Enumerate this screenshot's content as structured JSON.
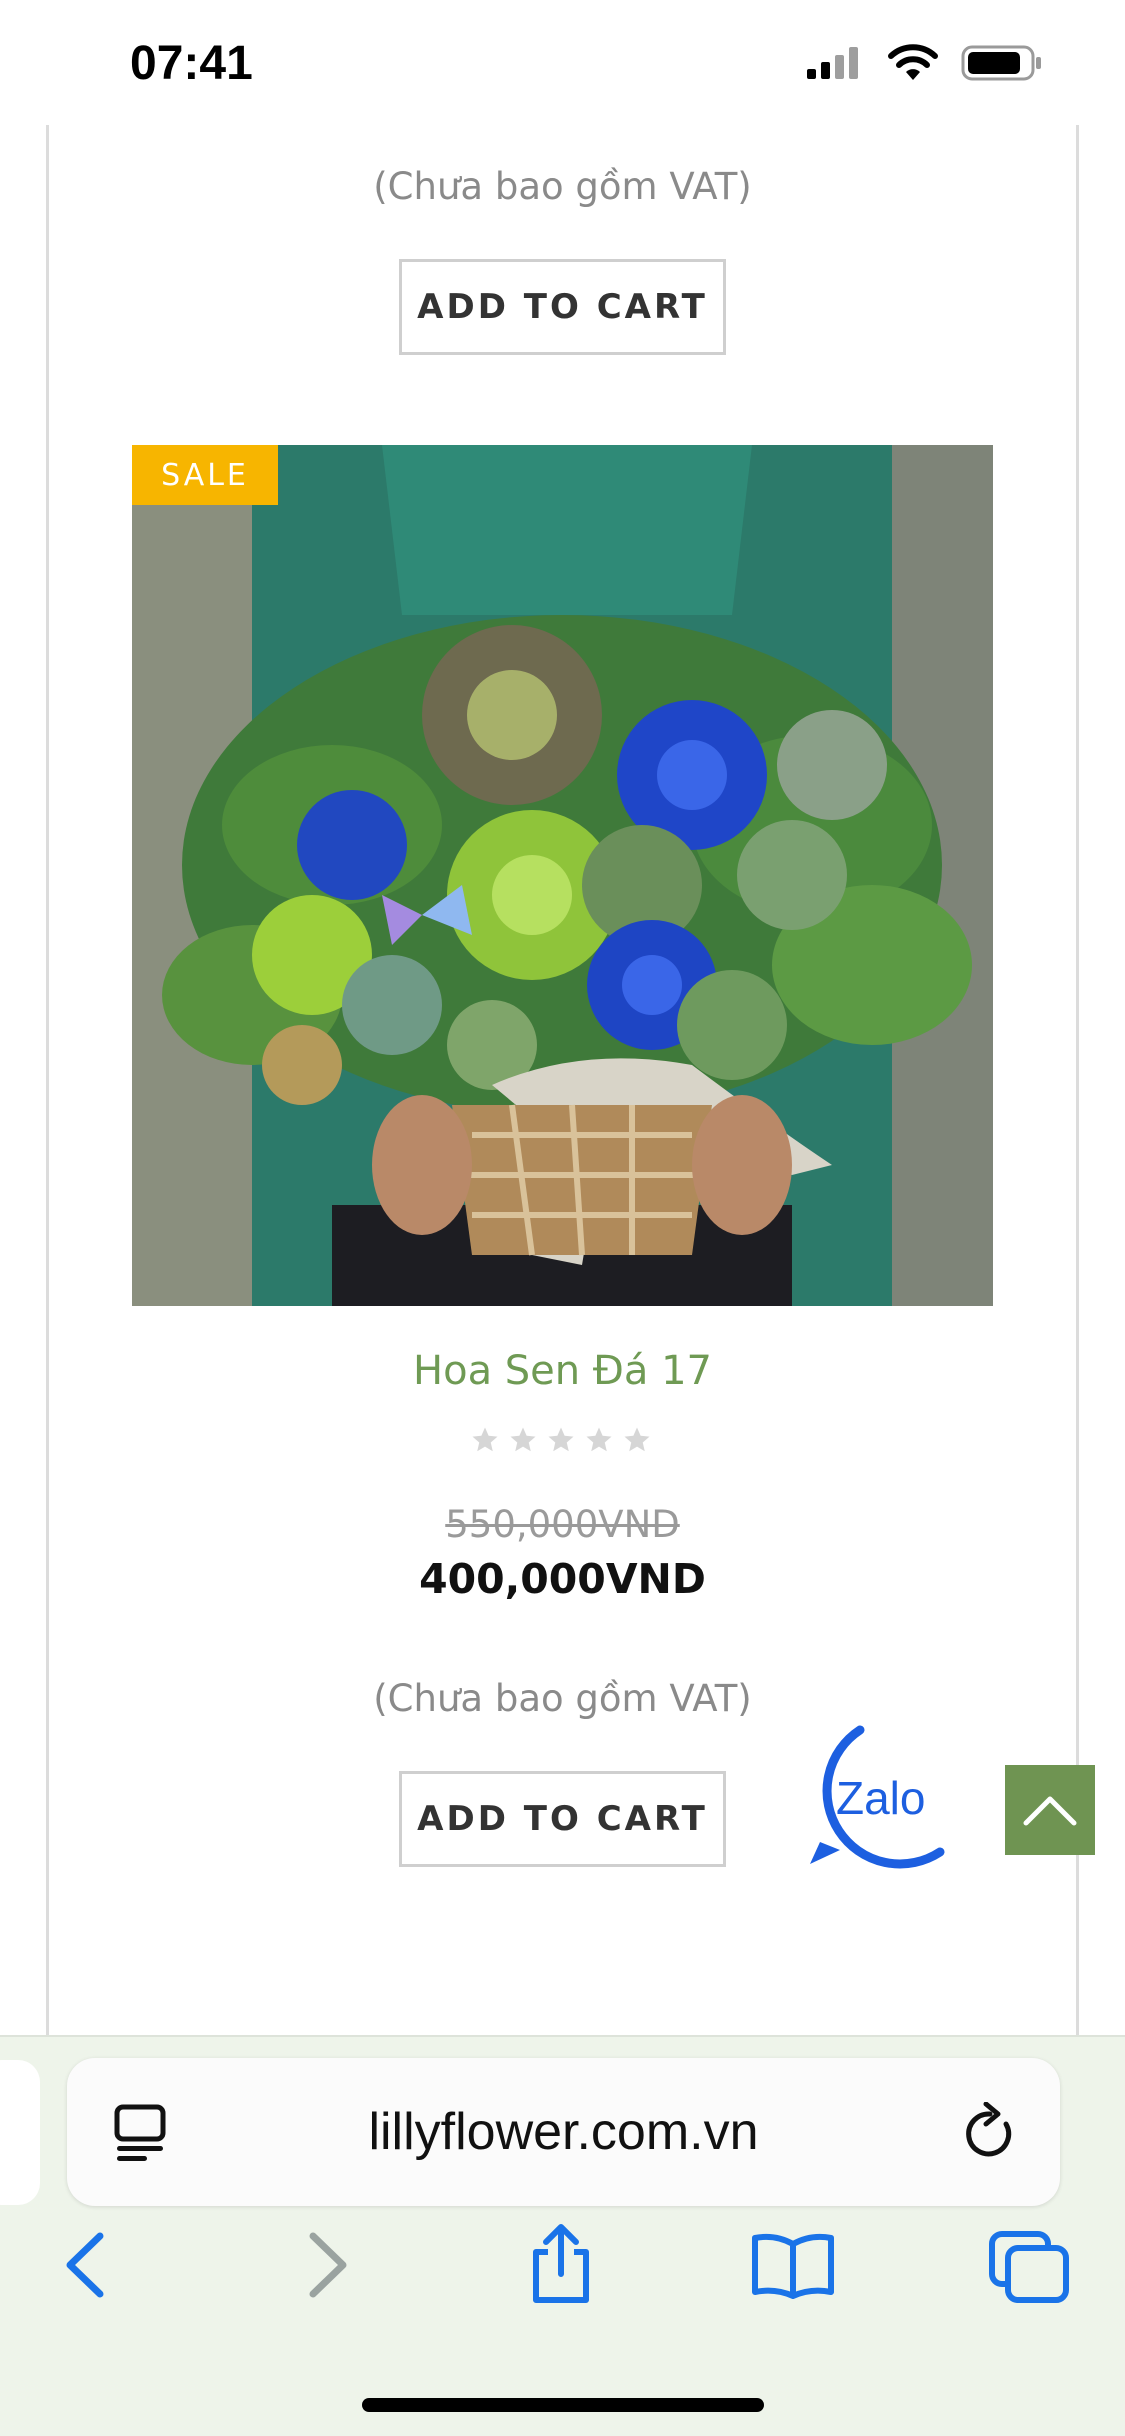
{
  "status_bar": {
    "time": "07:41"
  },
  "previous_product": {
    "vat_note": "(Chưa bao gồm VAT)",
    "add_to_cart": "ADD TO CART"
  },
  "product": {
    "badge": "SALE",
    "title": "Hoa Sen Đá 17",
    "rating_stars": 0,
    "rating_max": 5,
    "old_price": "550,000VND",
    "new_price": "400,000VND",
    "vat_note": "(Chưa bao gồm VAT)",
    "add_to_cart": "ADD TO CART"
  },
  "widgets": {
    "zalo_label": "Zalo"
  },
  "browser": {
    "url": "lillyflower.com.vn"
  },
  "colors": {
    "accent_green": "#6f9452",
    "title_green": "#6f9a54",
    "sale_badge": "#f7b500",
    "ios_blue": "#1a73e8"
  }
}
